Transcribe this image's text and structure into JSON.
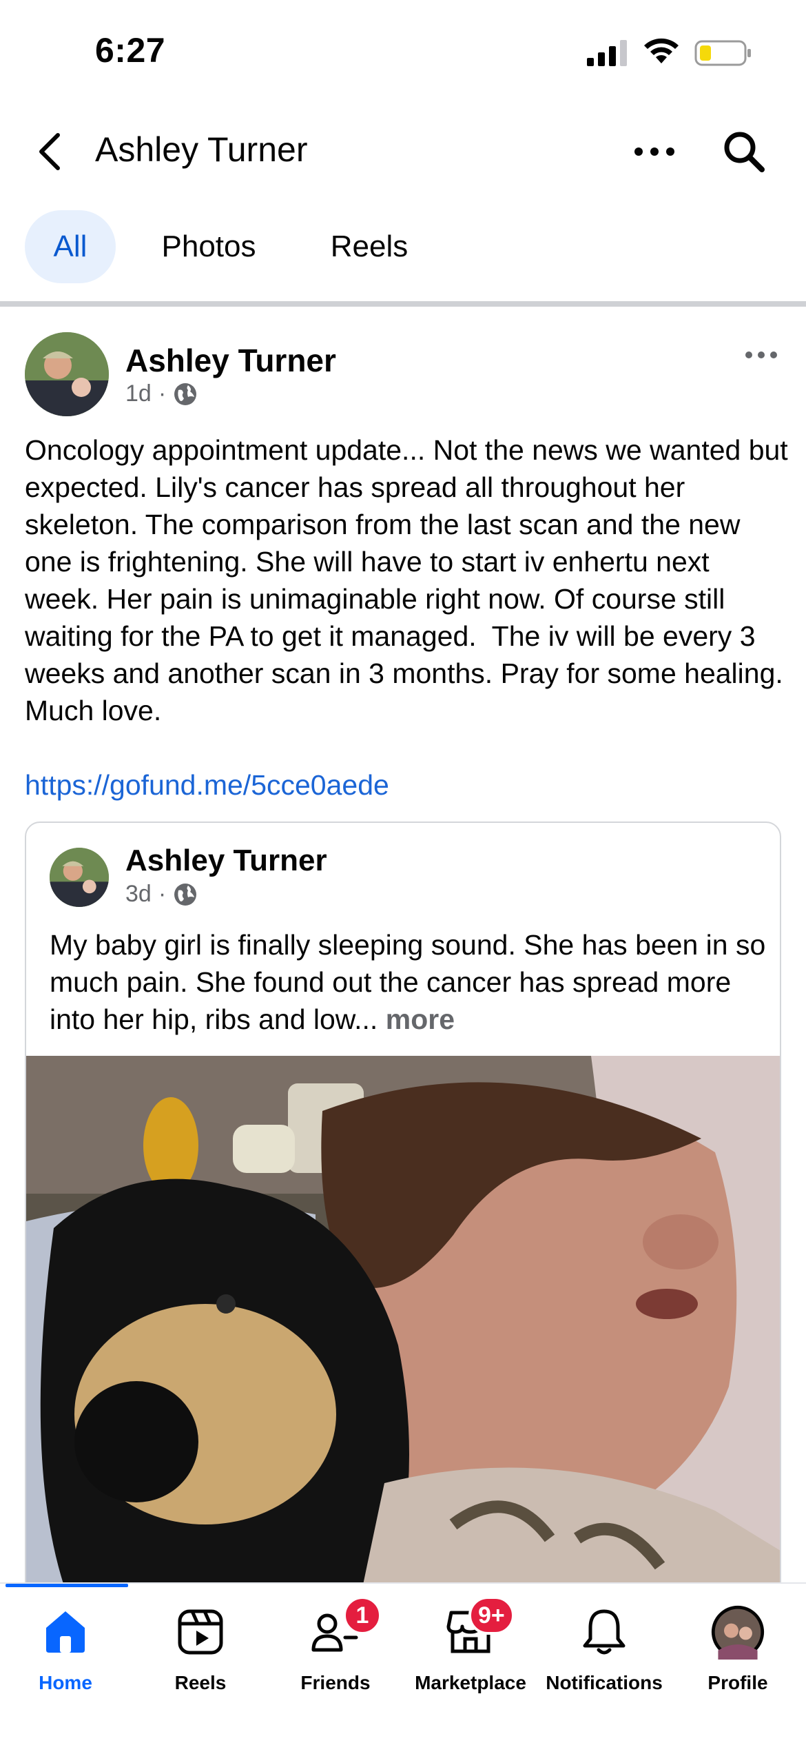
{
  "status_bar": {
    "time": "6:27"
  },
  "header": {
    "title": "Ashley Turner"
  },
  "tabs": [
    {
      "label": "All"
    },
    {
      "label": "Photos"
    },
    {
      "label": "Reels"
    }
  ],
  "post": {
    "author": "Ashley Turner",
    "time": "1d",
    "separator": "·",
    "text": "Oncology appointment update... Not the news we wanted but expected. Lily's cancer has spread all throughout her skeleton. The comparison from the last scan and the new one is frightening. She will have to start iv enhertu next week. Her pain is unimaginable right now. Of course still waiting for the PA to get it managed.  The iv will be every 3 weeks and another scan in 3 months. Pray for some healing. Much love.",
    "link": "https://gofund.me/5cce0aede"
  },
  "shared_post": {
    "author": "Ashley Turner",
    "time": "3d",
    "separator": "·",
    "text": "My baby girl is finally sleeping sound. She has been in so much pain. She found out the cancer has spread more into her hip, ribs and low...",
    "more_label": "more"
  },
  "bottom_nav": {
    "items": [
      {
        "label": "Home"
      },
      {
        "label": "Reels"
      },
      {
        "label": "Friends",
        "badge": "1"
      },
      {
        "label": "Marketplace",
        "badge": "9+"
      },
      {
        "label": "Notifications"
      },
      {
        "label": "Profile"
      }
    ]
  },
  "colors": {
    "accent": "#0866ff",
    "link": "#1b65d6",
    "badge": "#e41e3f",
    "tab_active_bg": "#e7f0fd"
  }
}
